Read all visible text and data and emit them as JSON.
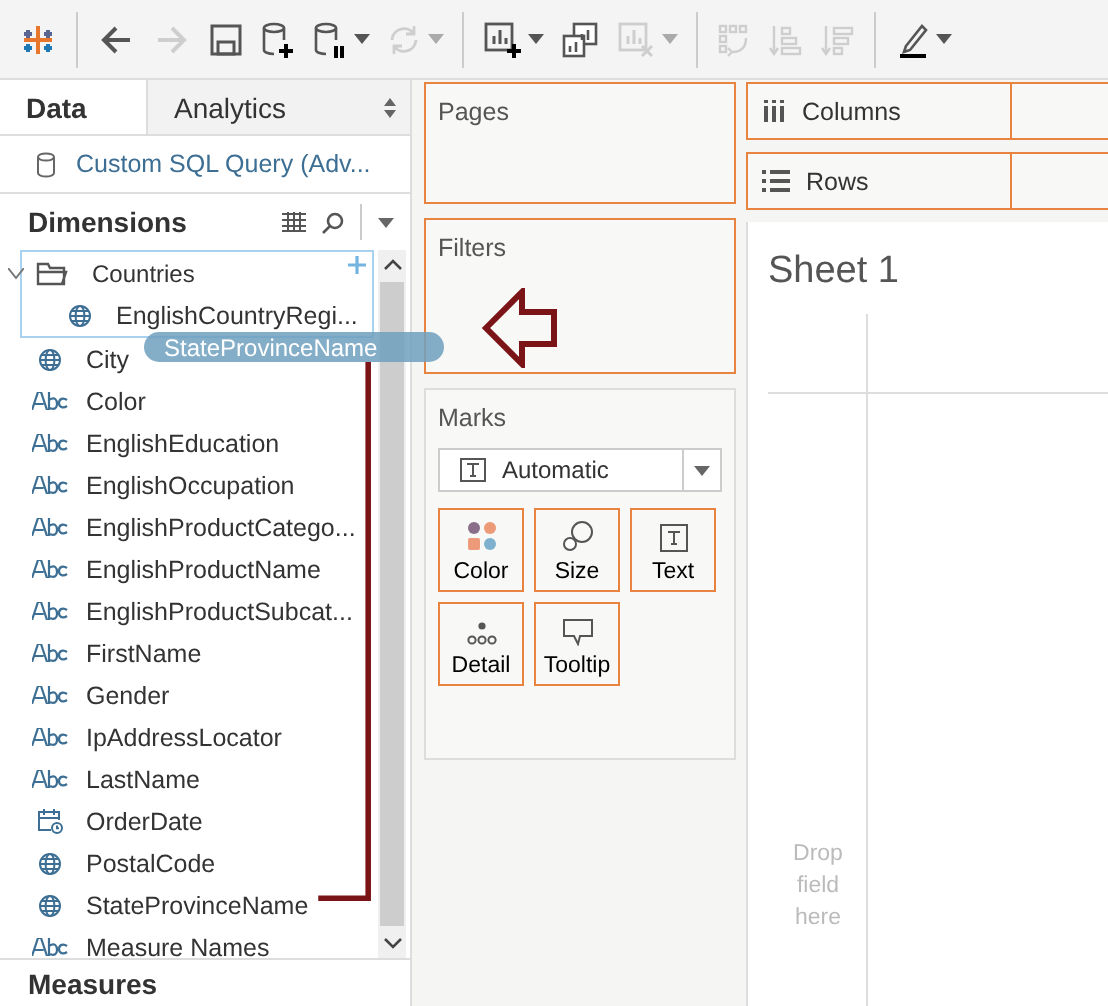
{
  "toolbar": {
    "buttons": [
      {
        "kind": "logo",
        "disabled": false,
        "menu": false
      },
      {
        "kind": "back",
        "disabled": false,
        "menu": false
      },
      {
        "kind": "forward",
        "disabled": true,
        "menu": false
      },
      {
        "kind": "save",
        "disabled": false,
        "menu": false
      },
      {
        "kind": "new-datasource",
        "disabled": false,
        "menu": false
      },
      {
        "kind": "pause",
        "disabled": false,
        "menu": true
      },
      {
        "kind": "refresh",
        "disabled": true,
        "menu": true
      },
      {
        "kind": "new-sheet",
        "disabled": false,
        "menu": true
      },
      {
        "kind": "duplicate",
        "disabled": false,
        "menu": false
      },
      {
        "kind": "clear",
        "disabled": true,
        "menu": true
      },
      {
        "kind": "swap",
        "disabled": true,
        "menu": false
      },
      {
        "kind": "sort-asc",
        "disabled": true,
        "menu": false
      },
      {
        "kind": "sort-desc",
        "disabled": true,
        "menu": false
      },
      {
        "kind": "highlight",
        "disabled": false,
        "menu": true
      }
    ]
  },
  "data_pane": {
    "tabs": [
      {
        "label": "Data",
        "selected": true
      },
      {
        "label": "Analytics",
        "selected": false
      }
    ],
    "datasource": "Custom SQL Query (Adv...",
    "dimensions_title": "Dimensions",
    "fields": [
      {
        "name": "Countries",
        "kind": "folder",
        "expanded": true,
        "highlighted": true,
        "children": [
          {
            "name": "EnglishCountryRegi...",
            "kind": "geo"
          }
        ]
      },
      {
        "name": "City",
        "kind": "geo"
      },
      {
        "name": "Color",
        "kind": "abc"
      },
      {
        "name": "EnglishEducation",
        "kind": "abc"
      },
      {
        "name": "EnglishOccupation",
        "kind": "abc"
      },
      {
        "name": "EnglishProductCatego...",
        "kind": "abc"
      },
      {
        "name": "EnglishProductName",
        "kind": "abc"
      },
      {
        "name": "EnglishProductSubcat...",
        "kind": "abc"
      },
      {
        "name": "FirstName",
        "kind": "abc"
      },
      {
        "name": "Gender",
        "kind": "abc"
      },
      {
        "name": "IpAddressLocator",
        "kind": "abc"
      },
      {
        "name": "LastName",
        "kind": "abc"
      },
      {
        "name": "OrderDate",
        "kind": "date"
      },
      {
        "name": "PostalCode",
        "kind": "geo"
      },
      {
        "name": "StateProvinceName",
        "kind": "geo"
      },
      {
        "name": "Measure Names",
        "kind": "abc"
      }
    ],
    "measures_title": "Measures"
  },
  "drag_pill": "StateProvinceName",
  "cards": {
    "pages": "Pages",
    "filters": "Filters",
    "marks": {
      "title": "Marks",
      "mark_type": "Automatic",
      "buttons": [
        {
          "label": "Color",
          "kind": "color"
        },
        {
          "label": "Size",
          "kind": "size"
        },
        {
          "label": "Text",
          "kind": "text"
        },
        {
          "label": "Detail",
          "kind": "detail"
        },
        {
          "label": "Tooltip",
          "kind": "tooltip"
        }
      ]
    }
  },
  "shelves": [
    {
      "label": "Columns",
      "kind": "columns"
    },
    {
      "label": "Rows",
      "kind": "rows"
    }
  ],
  "sheet": {
    "title": "Sheet 1",
    "drop_hint": "Drop field here"
  }
}
